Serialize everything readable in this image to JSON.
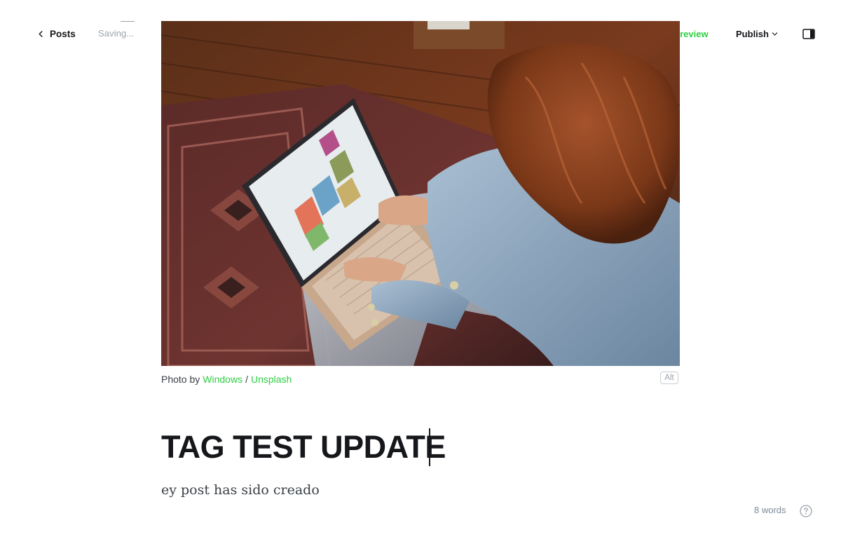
{
  "header": {
    "back_label": "Posts",
    "status": "Saving...",
    "preview_label": "Preview",
    "publish_label": "Publish",
    "accent_color": "#30cf43"
  },
  "feature_image": {
    "icon": "photo-laptop-woman-on-rug"
  },
  "caption": {
    "prefix": "Photo by",
    "author": "Windows",
    "separator": "/",
    "source": "Unsplash",
    "alt_label": "Alt"
  },
  "post": {
    "title": "TAG TEST UPDATE",
    "body": "ey post has sido creado"
  },
  "footer": {
    "word_count": "8 words",
    "help_icon": "question-circle-icon"
  }
}
